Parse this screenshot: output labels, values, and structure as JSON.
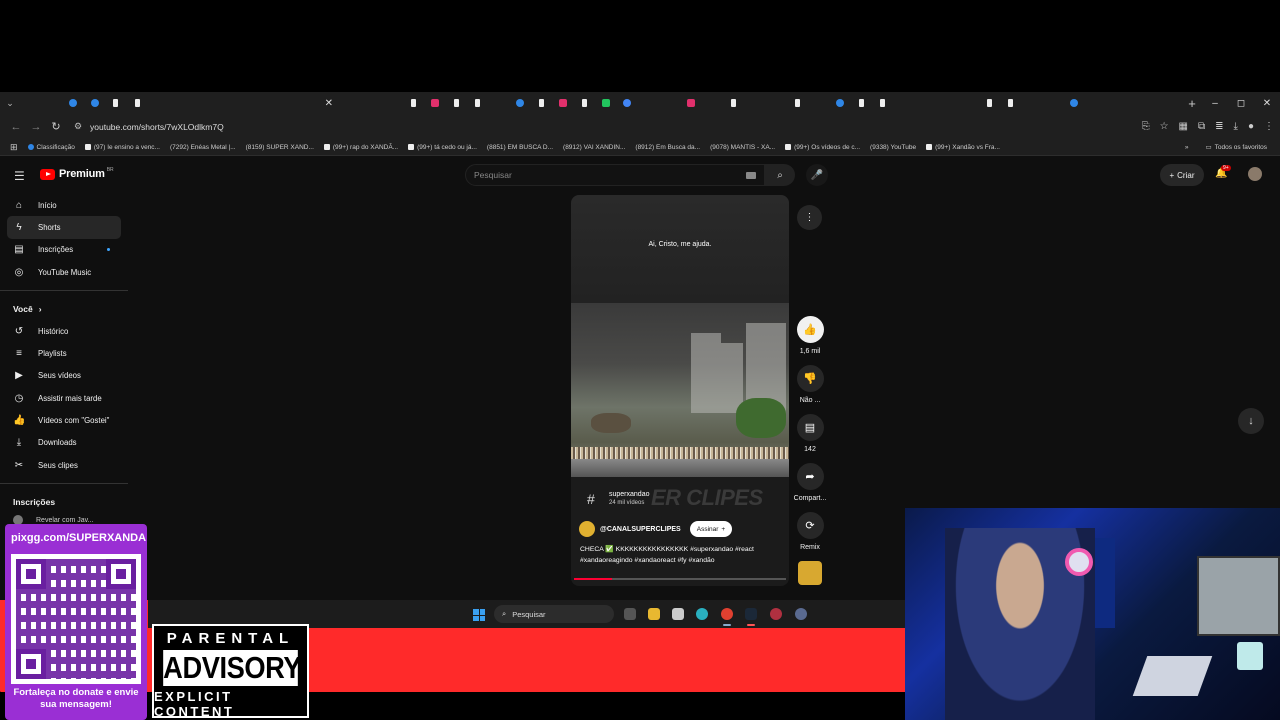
{
  "browser": {
    "tabs": [
      "yt",
      "yt",
      "c",
      "c",
      "tt",
      "tt",
      "yt",
      "yt",
      "yt",
      "yt",
      "yt",
      "yt",
      "yt",
      "yt",
      "x",
      "yt",
      "yt",
      "yt",
      "tt",
      "ig",
      "tt",
      "tt",
      "yt",
      "c",
      "tt",
      "ig",
      "tt",
      "k",
      "g",
      "yt",
      "yt",
      "ig",
      "yt",
      "tt",
      "yt",
      "yt",
      "tt",
      "yt",
      "c",
      "tt",
      "tt",
      "yt",
      "yt",
      "yt",
      "yt",
      "tt",
      "tt",
      "yt",
      "yt",
      "c"
    ],
    "url": "youtube.com/shorts/7wXLOdlkm7Q",
    "bookmarks": [
      {
        "label": "Classificação",
        "icon": "c"
      },
      {
        "label": "(97) Ie ensino a venc...",
        "icon": "tt"
      },
      {
        "label": "(7292) Enéas Metal |...",
        "icon": "yt"
      },
      {
        "label": "(8159) SUPER XAND...",
        "icon": "yt"
      },
      {
        "label": "(99+) rap do XANDÃ...",
        "icon": "tt"
      },
      {
        "label": "(99+) tá cedo ou já...",
        "icon": "tt"
      },
      {
        "label": "(8851) EM BUSCA D...",
        "icon": "yt"
      },
      {
        "label": "(8912) VAI XANDIN...",
        "icon": "yt"
      },
      {
        "label": "(8912) Em Busca da...",
        "icon": "yt"
      },
      {
        "label": "(9078) MANTIS - XA...",
        "icon": "yt"
      },
      {
        "label": "(99+) Os vídeos de c...",
        "icon": "tt"
      },
      {
        "label": "(9338) YouTube",
        "icon": "yt"
      },
      {
        "label": "(99+) Xandão vs Fra...",
        "icon": "tt"
      }
    ],
    "all_bookmarks": "Todos os favoritos"
  },
  "youtube": {
    "logo": "Premium",
    "logo_region": "BR",
    "search_placeholder": "Pesquisar",
    "create_label": "Criar",
    "notifications": "9+",
    "sidebar": {
      "main": [
        {
          "label": "Início",
          "icon": "⌂",
          "name": "home"
        },
        {
          "label": "Shorts",
          "icon": "ϟ",
          "name": "shorts",
          "active": true
        },
        {
          "label": "Inscrições",
          "icon": "▤",
          "name": "subscriptions",
          "dot": true
        },
        {
          "label": "YouTube Music",
          "icon": "◎",
          "name": "youtube-music"
        }
      ],
      "you_heading": "Você",
      "you": [
        {
          "label": "Histórico",
          "icon": "↺",
          "name": "history"
        },
        {
          "label": "Playlists",
          "icon": "≡",
          "name": "playlists"
        },
        {
          "label": "Seus vídeos",
          "icon": "▶",
          "name": "your-videos"
        },
        {
          "label": "Assistir mais tarde",
          "icon": "◷",
          "name": "watch-later"
        },
        {
          "label": "Vídeos com \"Gostei\"",
          "icon": "👍",
          "name": "liked-videos"
        },
        {
          "label": "Downloads",
          "icon": "⤓",
          "name": "downloads"
        },
        {
          "label": "Seus clipes",
          "icon": "✂",
          "name": "your-clips"
        }
      ],
      "subs_heading": "Inscrições",
      "subs_item": "Revelar com Jav..."
    },
    "short": {
      "caption": "Ai, Cristo, me ajuda.",
      "watermark": "ER CLIPES",
      "hashtag": "superxandao",
      "hashtag_count": "24 mil vídeos",
      "channel": "@CANALSUPERCLIPES",
      "subscribe": "Assinar",
      "description": "CHECA ✅ KKKKKKKKKKKKKKKK #superxandao #react #xandaoreagindo #xandaoreact #fy #xandão",
      "progress": 0.18
    },
    "actions": {
      "like_count": "1,6 mil",
      "dislike_label": "Não ...",
      "comments_count": "142",
      "share_label": "Compart...",
      "remix_label": "Remix"
    }
  },
  "taskbar": {
    "search_placeholder": "Pesquisar"
  },
  "overlay": {
    "qr_url": "pixgg.com/SUPERXANDA",
    "qr_message": "Fortaleça no donate e envie sua mensagem!",
    "advisory_top": "PARENTAL",
    "advisory_mid": "ADVISORY",
    "advisory_bottom": "EXPLICIT CONTENT"
  },
  "colors": {
    "yt_red": "#ff0000",
    "qr_purple": "#9a2fd4",
    "cam_blue": "#1530a0"
  }
}
